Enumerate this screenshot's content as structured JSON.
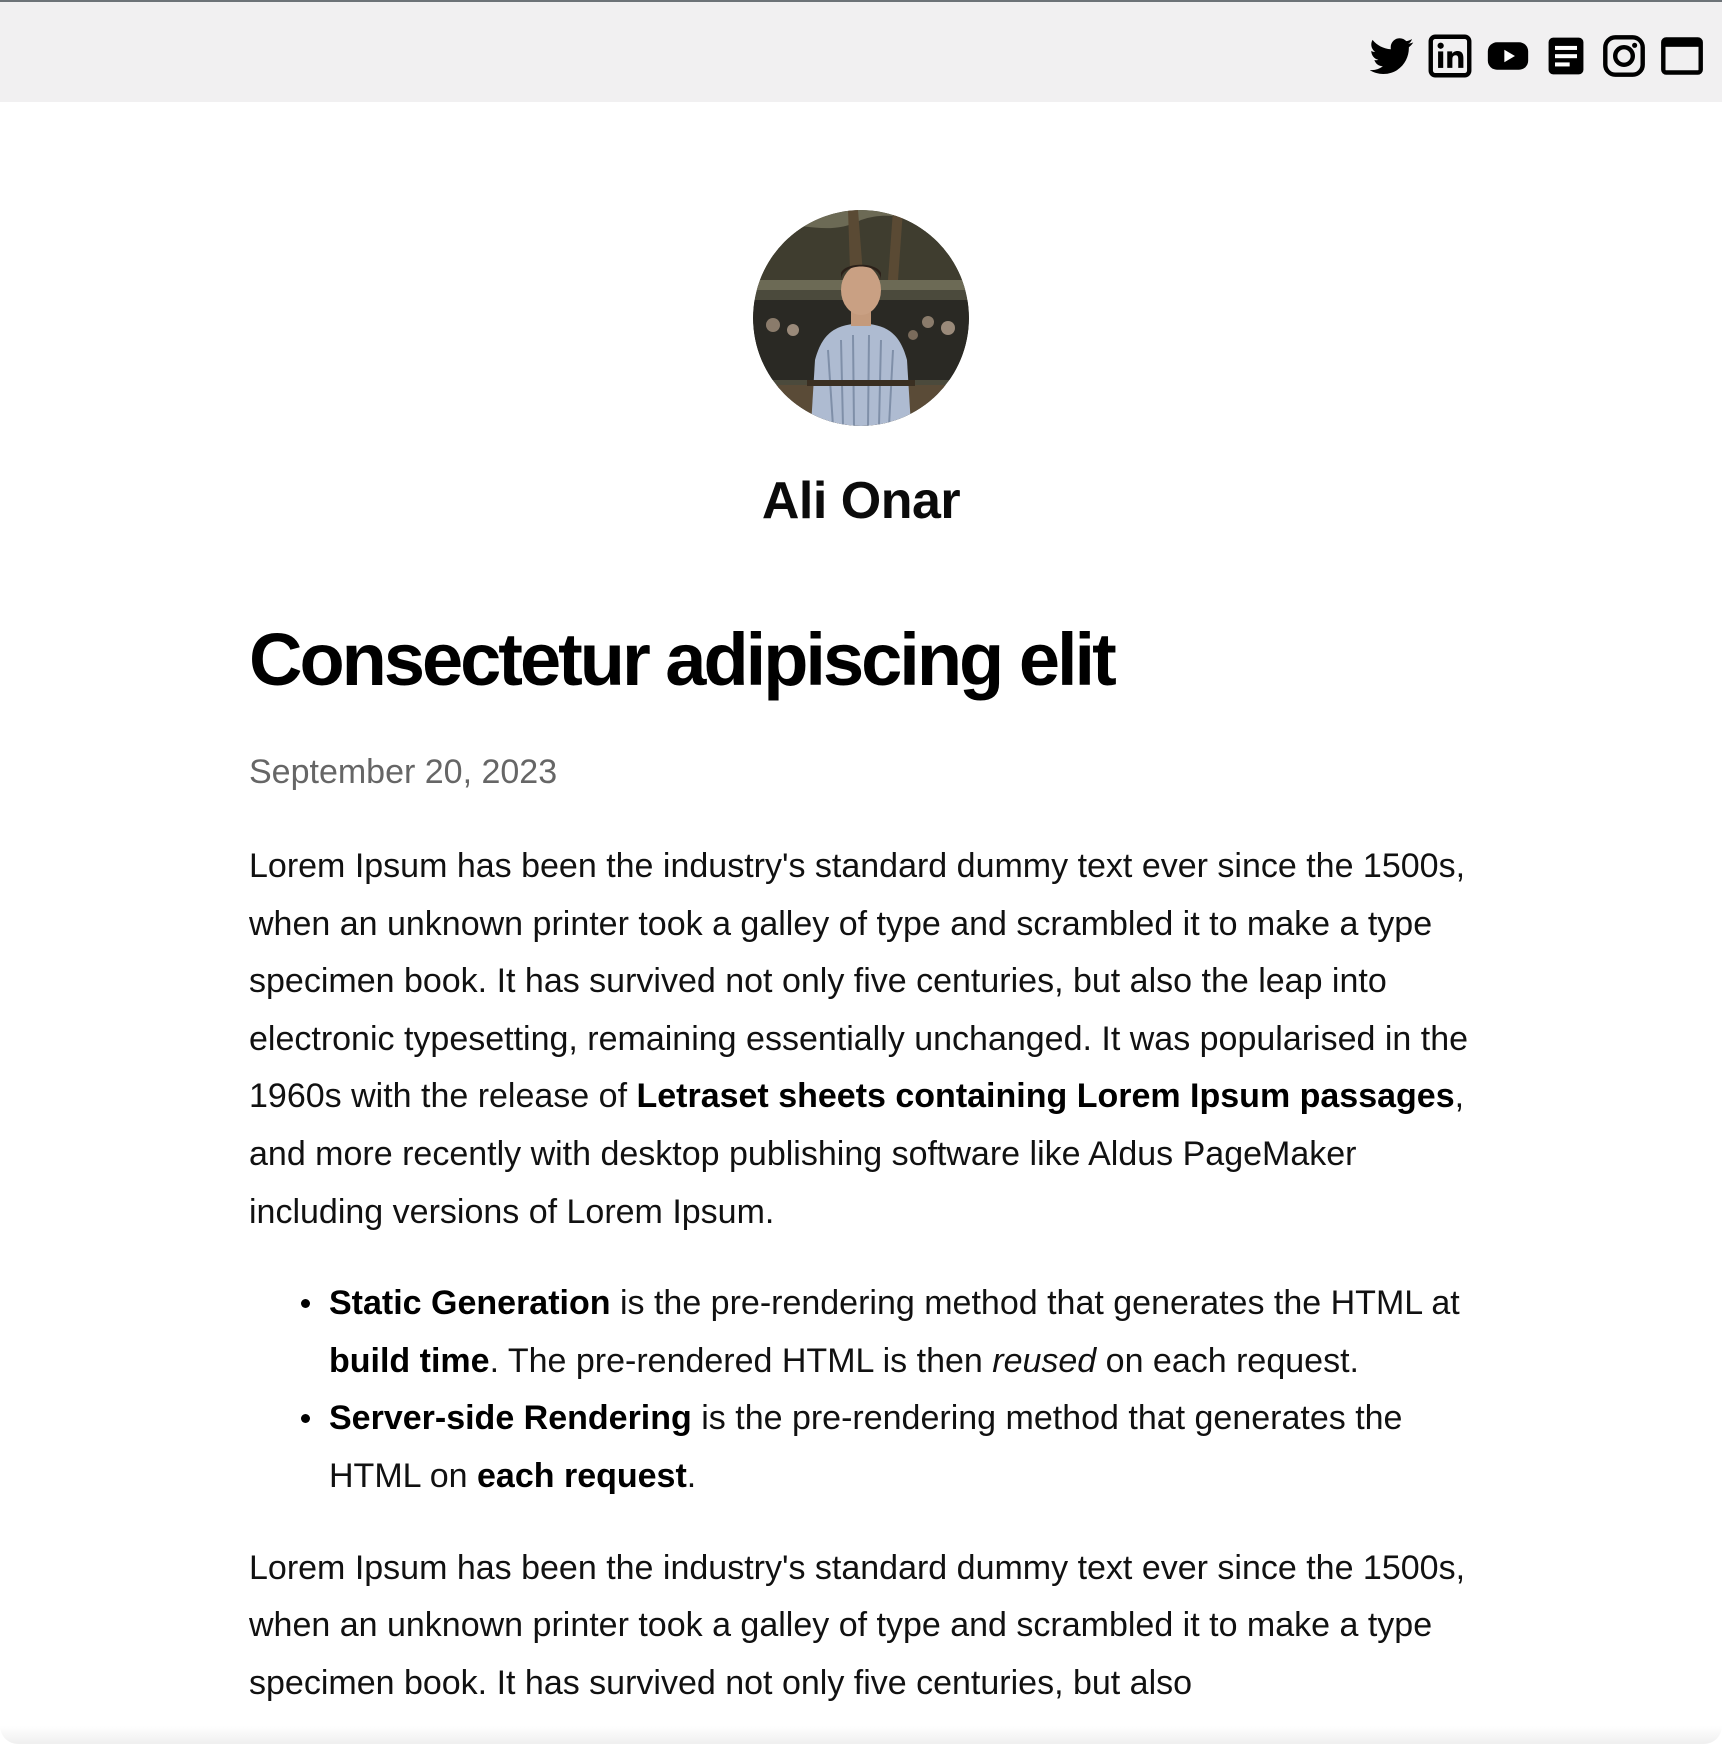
{
  "header": {
    "social_links": [
      {
        "name": "twitter",
        "icon": "twitter-icon"
      },
      {
        "name": "linkedin",
        "icon": "linkedin-icon"
      },
      {
        "name": "youtube",
        "icon": "youtube-icon"
      },
      {
        "name": "blog",
        "icon": "article-icon"
      },
      {
        "name": "instagram",
        "icon": "instagram-icon"
      },
      {
        "name": "website",
        "icon": "window-icon"
      }
    ]
  },
  "profile": {
    "name": "Ali Onar",
    "avatar_icon": "profile-photo"
  },
  "post": {
    "title": "Consectetur adipiscing elit",
    "date": "September 20, 2023",
    "paragraph1": {
      "part1": "Lorem Ipsum has been the industry's standard dummy text ever since the 1500s, when an unknown printer took a galley of type and scrambled it to make a type specimen book. It has survived not only five centuries, but also the leap into electronic typesetting, remaining essentially unchanged. It was popularised in the 1960s with the release of ",
      "bold": "Letraset sheets containing Lorem Ipsum passages",
      "part2": ", and more recently with desktop publishing software like Aldus PageMaker including versions of Lorem Ipsum."
    },
    "list": [
      {
        "bold_term": "Static Generation",
        "text1": " is the pre-rendering method that generates the HTML at ",
        "bold2": "build time",
        "text2": ". The pre-rendered HTML is then ",
        "italic": "reused",
        "text3": " on each request."
      },
      {
        "bold_term": "Server-side Rendering",
        "text1": " is the pre-rendering method that generates the HTML on ",
        "bold2": "each request",
        "text2": "."
      }
    ],
    "paragraph2": "Lorem Ipsum has been the industry's standard dummy text ever since the 1500s, when an unknown printer took a galley of type and scrambled it to make a type specimen book. It has survived not only five centuries, but also"
  }
}
